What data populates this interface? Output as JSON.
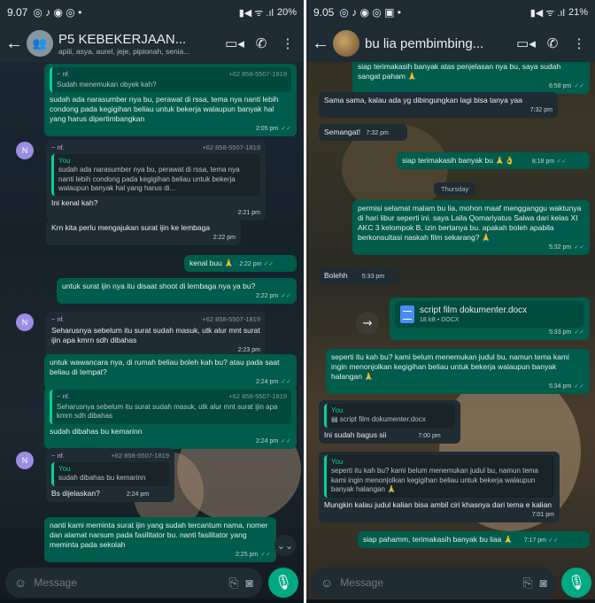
{
  "left": {
    "status": {
      "time": "9.07",
      "battery": "20%"
    },
    "header": {
      "title": "P5 KEBEKERJAAN...",
      "subtitle": "apiii, asya, aurel, jeje, pipionah, senia..."
    },
    "messages": {
      "m1": {
        "sender": "~ nf.",
        "phone": "+62 858-5507-1819",
        "quote": "Sudah menemukan obyek kah?",
        "text": "sudah ada narasumber nya bu, perawat di rssa, tema nya nanti lebih condong pada kegigihan beliau untuk bekerja walaupun banyak hal yang harus dipertimbangkan",
        "time": "2:05 pm"
      },
      "m2": {
        "avatar": "N",
        "sender": "~ nf.",
        "phone": "+62 858-5507-1819",
        "quote_name": "You",
        "quote": "sudah ada narasumber nya bu, perawat di rssa, tema nya nanti lebih condong pada kegigihan beliau untuk bekerja walaupun banyak hal yang harus di...",
        "text": "Ini kenal kah?",
        "time": "2:21 pm"
      },
      "m3": {
        "text": "Krn kita perlu mengajukan surat ijin ke lembaga",
        "time": "2:22 pm"
      },
      "m4": {
        "text": "kenal buu 🙏",
        "time": "2:22 pm"
      },
      "m5": {
        "text": "untuk surat ijin nya itu disaat shoot di lembaga nya ya bu?",
        "time": "2:22 pm"
      },
      "m6": {
        "avatar": "N",
        "sender": "~ nf.",
        "phone": "+62 858-5507-1819",
        "text": "Seharusnya sebelum itu surat sudah masuk, utk alur mnt surat ijin apa kmrn sdh dibahas",
        "time": "2:23 pm"
      },
      "m7": {
        "text": "untuk wawancara nya, di rumah beliau boleh kah bu? atau pada saat beliau di tempat?",
        "time": "2:24 pm"
      },
      "m8": {
        "sender": "~ nf.",
        "phone": "+62 858-5507-1819",
        "quote": "Seharusnya sebelum itu surat sudah masuk, utk alur mnt surat ijin apa kmrn sdh dibahas",
        "text": "sudah dibahas bu kemarinn",
        "time": "2:24 pm"
      },
      "m9": {
        "avatar": "N",
        "sender": "~ nf.",
        "phone": "+62 858-5507-1819",
        "quote_name": "You",
        "quote": "sudah dibahas bu kemarinn",
        "text": "Bs dijelaskan?",
        "time": "2:24 pm"
      },
      "m10": {
        "text": "nanti kami meminta surat ijin yang sudah tercantum nama, nomer dan alamat narsum pada fasilitator bu. nanti fasilitator yang meminta pada sekolah",
        "time": "2:25 pm"
      }
    },
    "composer": {
      "placeholder": "Message"
    }
  },
  "right": {
    "status": {
      "time": "9.05",
      "battery": "21%"
    },
    "header": {
      "title": "bu lia pembimbing..."
    },
    "messages": {
      "r1": {
        "text": "siap terimakasih banyak atas penjelasan nya bu, saya sudah sangat paham 🙏",
        "time": "6:58 pm"
      },
      "r2": {
        "text": "Sama sama, kalau ada yg dibingungkan lagi bisa tanya yaa",
        "time": "7:32 pm"
      },
      "r3": {
        "text": "Semangat!",
        "time": "7:32 pm"
      },
      "r4": {
        "text": "siap terimakasih banyak bu 🙏👌",
        "time": "8:18 pm"
      },
      "day": "Thursday",
      "r5": {
        "text": "permisi selamat malam bu lia, mohon maaf mengganggu waktunya di hari libur seperti ini. saya Laila Qomariyatus Salwa dari kelas XI AKC 3 kelompok B, izin bertanya bu. apakah boleh apabila berkonsultasi naskah film sekarang? 🙏",
        "time": "5:32 pm"
      },
      "r6": {
        "text": "Bolehh",
        "time": "5:33 pm"
      },
      "r7": {
        "doc_name": "script film dokumenter.docx",
        "doc_meta": "18 kB • DOCX",
        "time": "5:33 pm"
      },
      "r8": {
        "text": "seperti itu kah bu? kami belum menemukan judul bu, namun tema kami ingin menonjolkan kegigihan beliau untuk bekerja walaupun banyak halangan 🙏",
        "time": "5:34 pm"
      },
      "r9": {
        "quote_name": "You",
        "quote": "script film dokumenter.docx",
        "text": "Ini sudah bagus sii",
        "time": "7:00 pm"
      },
      "r10": {
        "quote_name": "You",
        "quote": "seperti itu kah bu? kami belum menemukan judul bu, namun tema kami ingin menonjolkan kegigihan beliau untuk bekerja walaupun banyak halangan 🙏",
        "text": "Mungkin kalau judul kalian bisa ambil ciri khasnya dari tema e kalian",
        "time": "7:01 pm"
      },
      "r11": {
        "text": "siap pahamm, terimakasih banyak bu liaa 🙏",
        "time": "7:17 pm"
      }
    },
    "composer": {
      "placeholder": "Message"
    }
  },
  "colors": {
    "outgoing": "#005c4b",
    "incoming": "#202c33",
    "accent": "#00a884",
    "tick": "#53bdeb"
  }
}
